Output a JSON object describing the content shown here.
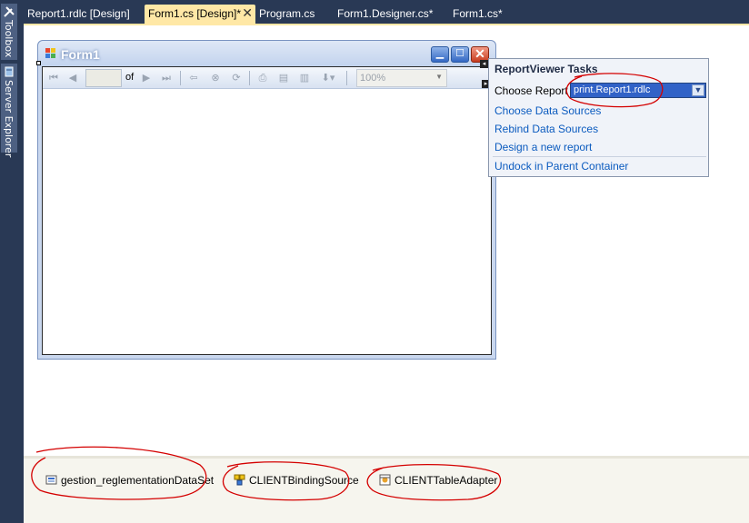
{
  "sidebar": {
    "toolbox_label": "Toolbox",
    "server_explorer_label": "Server Explorer"
  },
  "tabs": [
    {
      "label": "Report1.rdlc [Design]"
    },
    {
      "label": "Form1.cs [Design]*"
    },
    {
      "label": "Program.cs"
    },
    {
      "label": "Form1.Designer.cs*"
    },
    {
      "label": "Form1.cs*"
    }
  ],
  "form": {
    "title": "Form1",
    "toolbar": {
      "of_label": "of",
      "zoom_value": "100%"
    }
  },
  "tasks_panel": {
    "header": "ReportViewer Tasks",
    "choose_report_label": "Choose Report",
    "choose_report_value": "print.Report1.rdlc",
    "links": {
      "choose_data_sources": "Choose Data Sources",
      "rebind_data_sources": "Rebind Data Sources",
      "design_new_report": "Design a new report",
      "undock": "Undock in Parent Container"
    }
  },
  "component_tray": {
    "items": [
      {
        "label": "gestion_reglementationDataSet"
      },
      {
        "label": "CLIENTBindingSource"
      },
      {
        "label": "CLIENTTableAdapter"
      }
    ]
  },
  "colors": {
    "ide_chrome": "#293955",
    "active_tab": "#ffe8a6",
    "link": "#0b5bbf",
    "annotation": "#d40000"
  }
}
